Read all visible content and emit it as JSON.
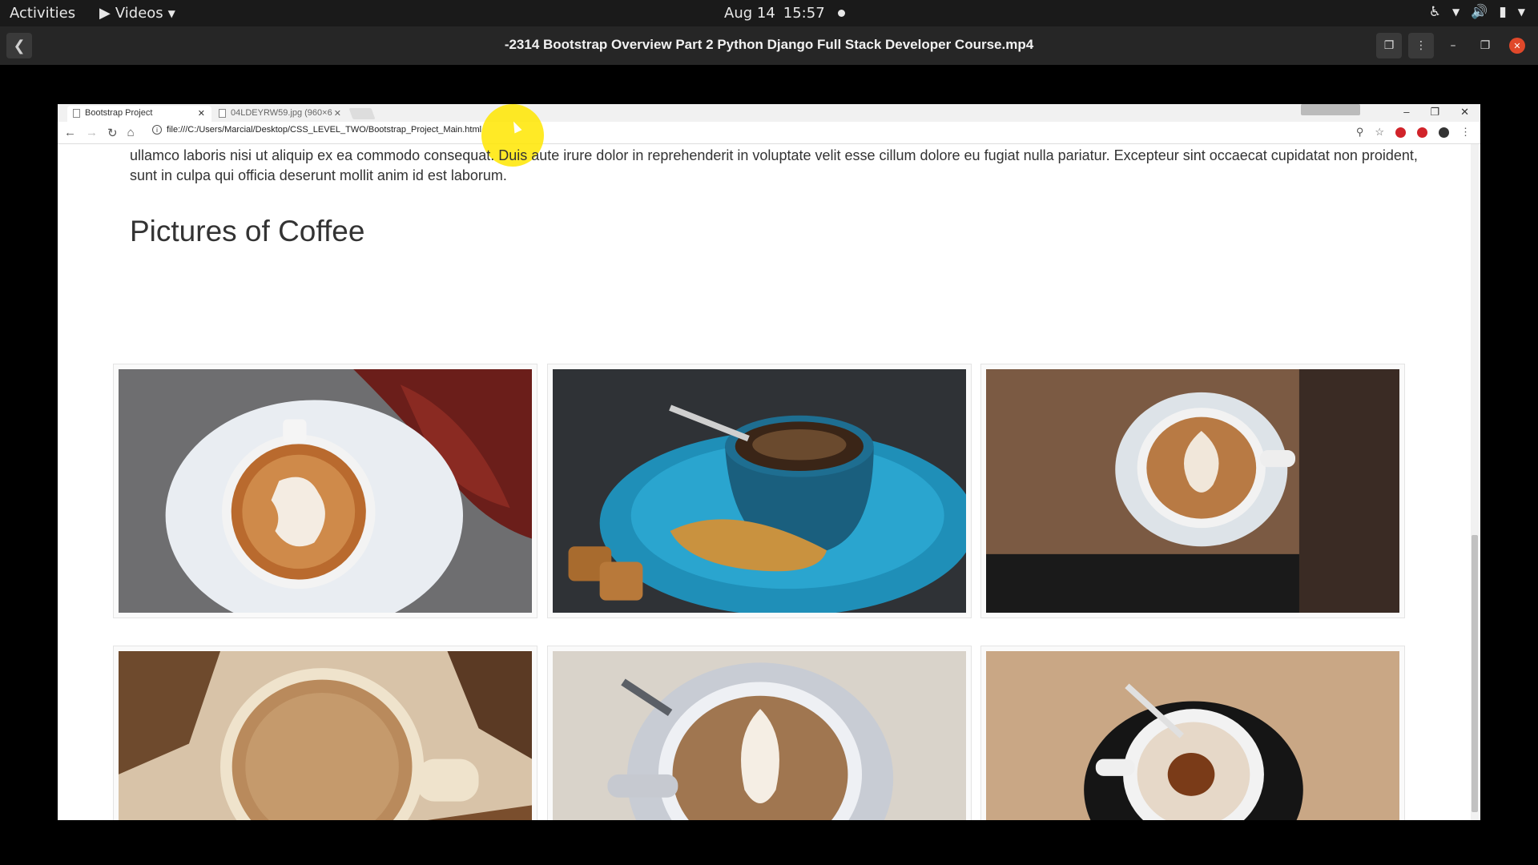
{
  "topbar": {
    "activities": "Activities",
    "app_menu": "Videos",
    "date": "Aug 14",
    "time": "15:57"
  },
  "player": {
    "title": "-2314 Bootstrap Overview Part 2 Python Django Full Stack Developer Course.mp4"
  },
  "browser": {
    "tabs": [
      {
        "label": "Bootstrap Project",
        "active": true
      },
      {
        "label": "04LDEYRW59.jpg (960×6",
        "active": false
      }
    ],
    "url": "file:///C:/Users/Marcial/Desktop/CSS_LEVEL_TWO/Bootstrap_Project_Main.html"
  },
  "page": {
    "paragraph": "ullamco laboris nisi ut aliquip ex ea commodo consequat. Duis aute irure dolor in reprehenderit in voluptate velit esse cillum dolore eu fugiat nulla pariatur. Excepteur sint occaecat cupidatat non proident, sunt in culpa qui officia deserunt mollit anim id est laborum.",
    "heading": "Pictures of Coffee"
  },
  "colors": {
    "topbar_bg": "#1a1a1a",
    "player_bar_bg": "#262626",
    "close_button": "#e0482a",
    "cursor_highlight": "#ffe600"
  }
}
